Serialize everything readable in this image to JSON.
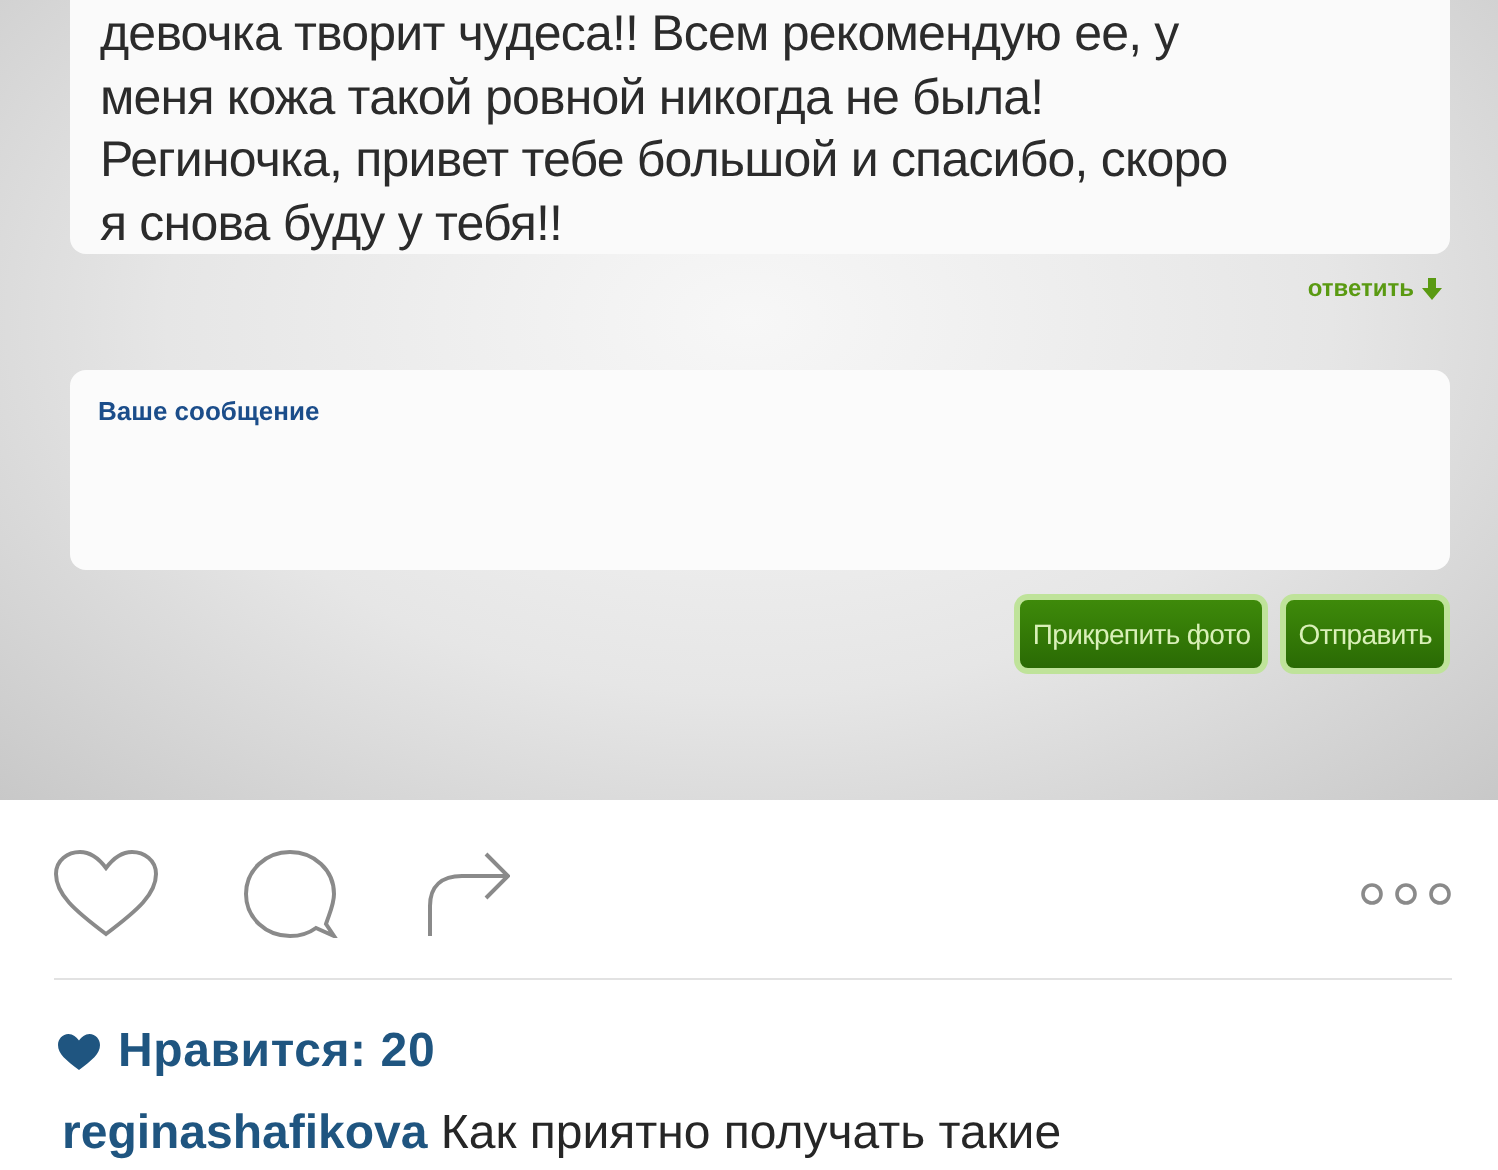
{
  "post_image": {
    "comment": {
      "text": "девочка творит чудеса!! Всем рекомендую ее, у\nменя кожа такой ровной никогда не была!\nРегиночка, привет тебе большой и спасибо, скоро\nя снова буду у тебя!!"
    },
    "reply_link": "ответить",
    "message_field": {
      "placeholder": "Ваше сообщение"
    },
    "buttons": [
      "Прикрепить фото",
      "Отправить"
    ]
  },
  "likes": {
    "label": "Нравится: 20"
  },
  "caption": {
    "username": "reginashafikova",
    "text": "Как приятно получать такие"
  }
}
